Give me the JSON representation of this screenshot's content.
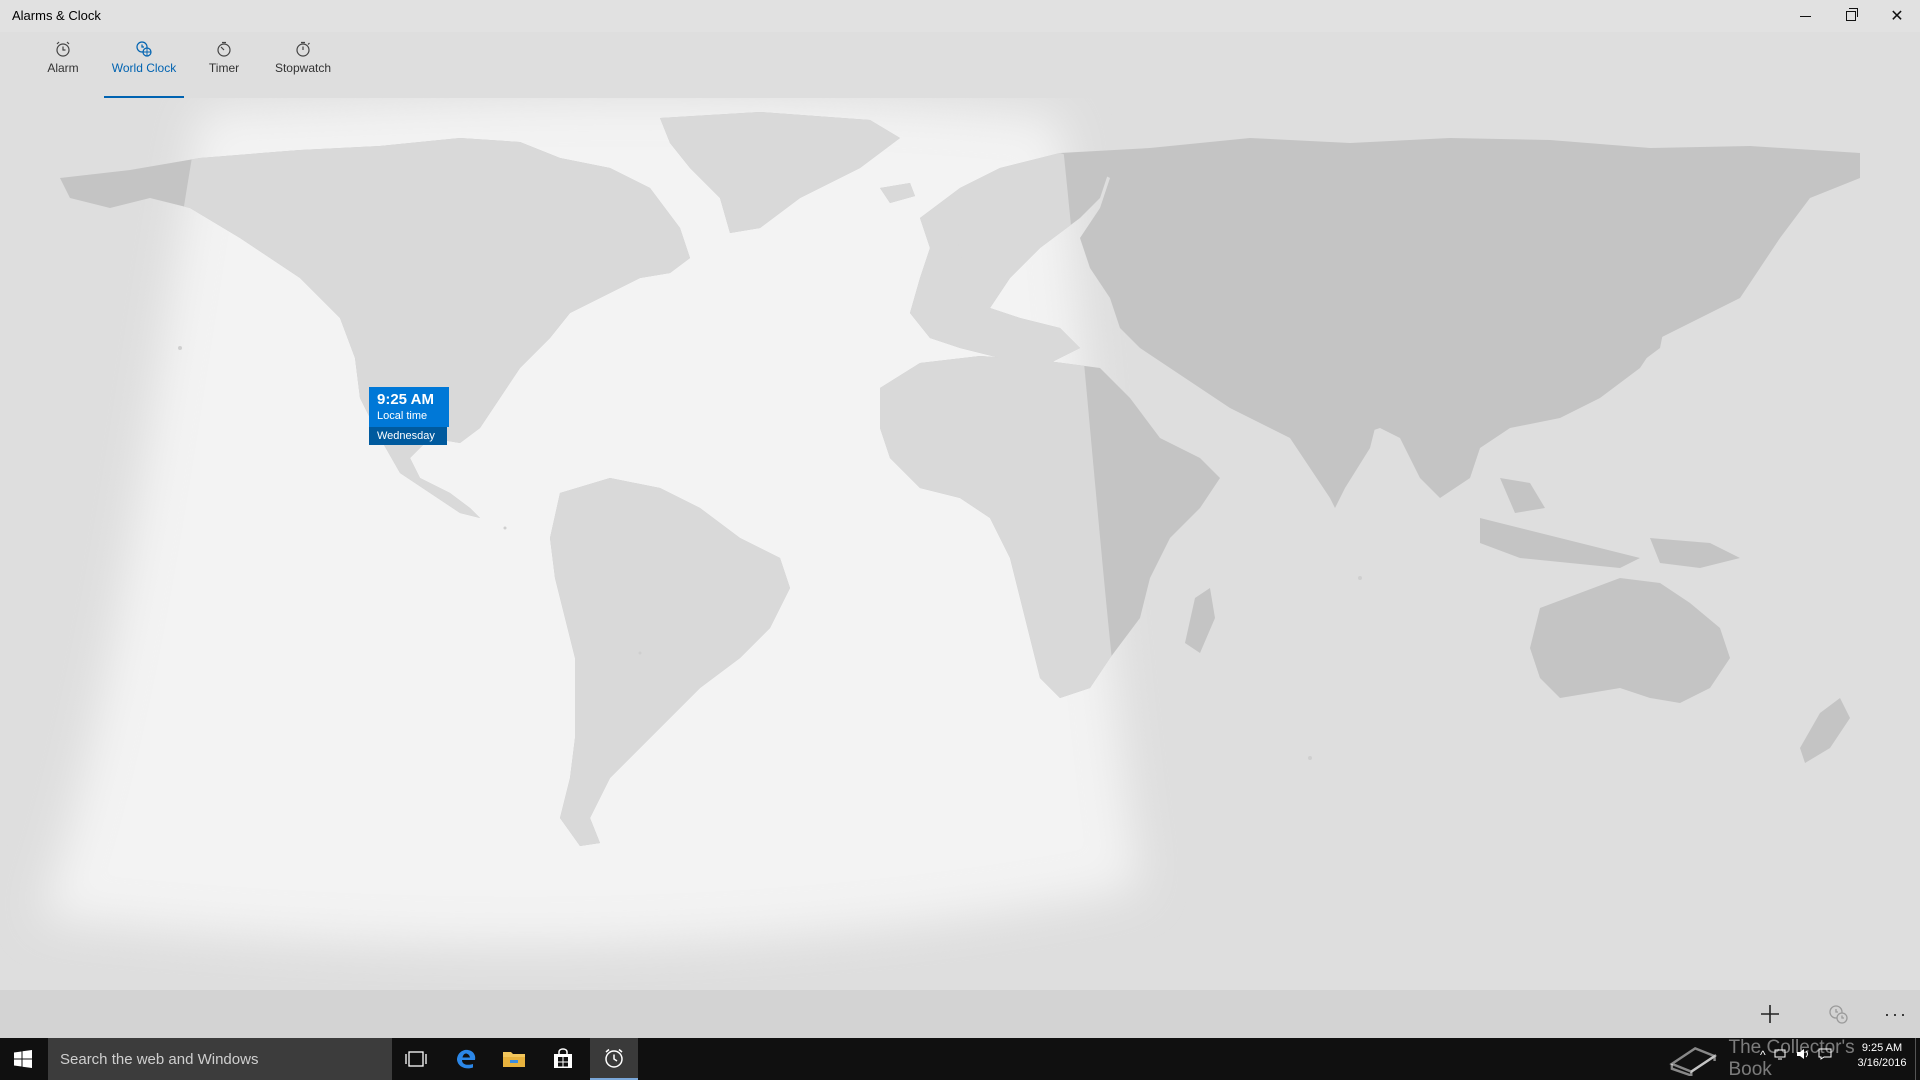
{
  "window": {
    "title": "Alarms & Clock"
  },
  "tabs": [
    {
      "label": "Alarm",
      "icon": "alarm-clock-icon"
    },
    {
      "label": "World Clock",
      "icon": "world-clock-icon",
      "active": true
    },
    {
      "label": "Timer",
      "icon": "timer-icon"
    },
    {
      "label": "Stopwatch",
      "icon": "stopwatch-icon"
    }
  ],
  "local_clock": {
    "time": "9:25 AM",
    "label": "Local time",
    "day": "Wednesday"
  },
  "command_bar": {
    "add_icon": "plus-icon",
    "compare_icon": "compare-clocks-icon",
    "more_icon": "more-ellipsis-icon",
    "more_label": "···"
  },
  "taskbar": {
    "search_placeholder": "Search the web and Windows",
    "watermark": "The Collector's Book",
    "clock_time": "9:25 AM",
    "clock_date": "3/16/2016"
  },
  "colors": {
    "accent": "#0078d7",
    "accent_dark": "#005a9e",
    "land_day": "#d7d7d7",
    "land_night": "#c2c2c2",
    "day_region": "#f3f3f3",
    "night_region": "#dedede"
  }
}
